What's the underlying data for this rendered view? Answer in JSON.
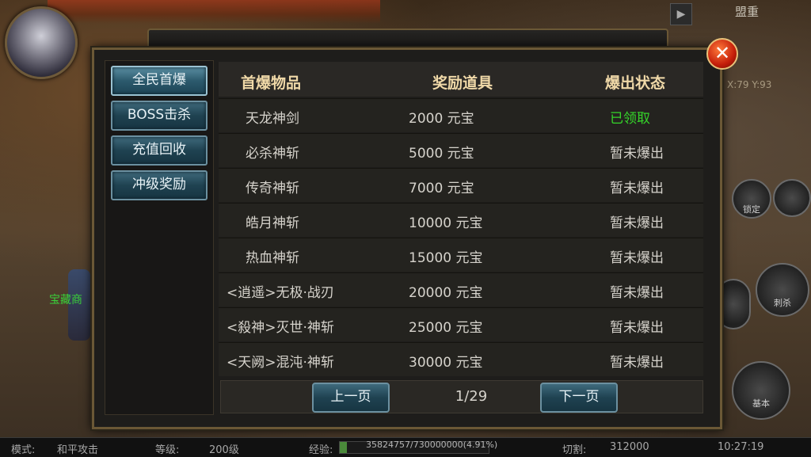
{
  "hud": {
    "top_right_label": "盟重",
    "coords": "X:79  Y:93",
    "npc_name": "宝藏商",
    "skills": {
      "lock": "锁定",
      "slash": "刺杀",
      "basic": "基本"
    }
  },
  "sidebar": {
    "tabs": [
      {
        "label": "全民首爆",
        "active": true
      },
      {
        "label": "BOSS击杀",
        "active": false
      },
      {
        "label": "充值回收",
        "active": false
      },
      {
        "label": "冲级奖励",
        "active": false
      }
    ]
  },
  "table": {
    "headers": [
      "首爆物品",
      "奖励道具",
      "爆出状态"
    ],
    "rows": [
      {
        "item": "天龙神剑",
        "reward": "2000 元宝",
        "status": "已领取",
        "claimed": true
      },
      {
        "item": "必杀神斩",
        "reward": "5000 元宝",
        "status": "暂未爆出",
        "claimed": false
      },
      {
        "item": "传奇神斩",
        "reward": "7000 元宝",
        "status": "暂未爆出",
        "claimed": false
      },
      {
        "item": "皓月神斩",
        "reward": "10000 元宝",
        "status": "暂未爆出",
        "claimed": false
      },
      {
        "item": "热血神斩",
        "reward": "15000 元宝",
        "status": "暂未爆出",
        "claimed": false
      },
      {
        "item": "<逍遥>无极·战刃",
        "reward": "20000 元宝",
        "status": "暂未爆出",
        "claimed": false
      },
      {
        "item": "<殺神>灭世·神斩",
        "reward": "25000 元宝",
        "status": "暂未爆出",
        "claimed": false
      },
      {
        "item": "<天阙>混沌·神斩",
        "reward": "30000 元宝",
        "status": "暂未爆出",
        "claimed": false
      }
    ]
  },
  "pagination": {
    "prev_label": "上一页",
    "next_label": "下一页",
    "page_info": "1/29"
  },
  "status_bar": {
    "mode_label": "模式:",
    "mode_value": "和平攻击",
    "level_label": "等级:",
    "level_value": "200级",
    "exp_label": "经验:",
    "exp_value": "35824757/730000000(4.91%)",
    "exp_fraction": 0.0491,
    "cut_label": "切割:",
    "cut_value": "312000",
    "time": "10:27:19"
  },
  "colors": {
    "claimed": "#35d52a",
    "header_text": "#f0d9a8",
    "button_blue": "#1f4251"
  }
}
